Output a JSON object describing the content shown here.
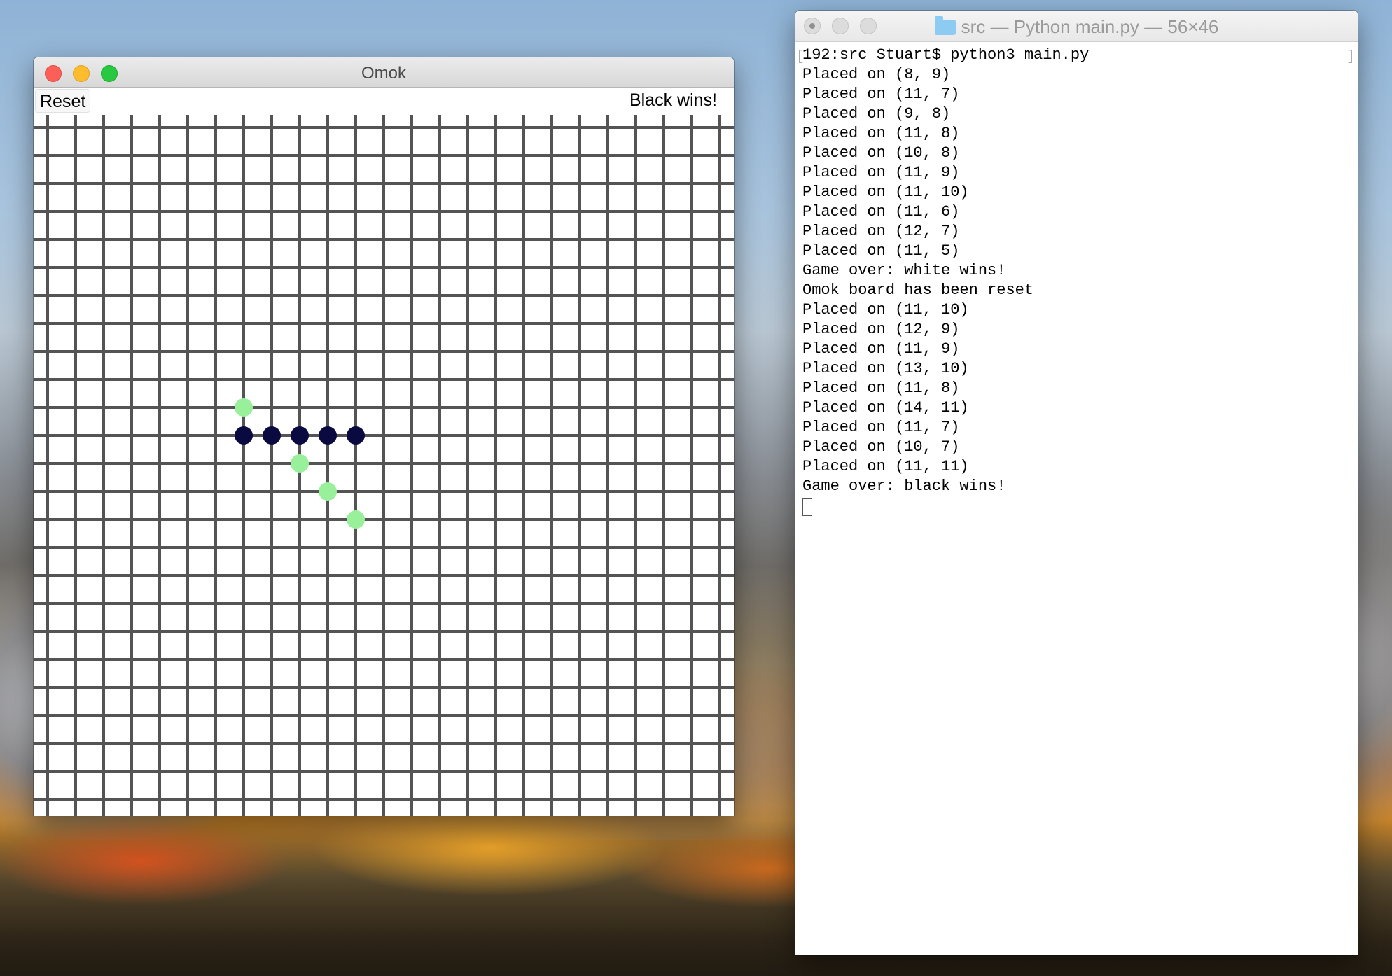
{
  "omok": {
    "window_title": "Omok",
    "reset_label": "Reset",
    "status": "Black wins!",
    "board": {
      "grid_color": "#545454",
      "black_stone_color": "#0a0a40",
      "white_stone_color": "#98f09a",
      "black_stones": [
        [
          7,
          11
        ],
        [
          8,
          11
        ],
        [
          9,
          11
        ],
        [
          10,
          11
        ],
        [
          11,
          11
        ]
      ],
      "white_stones": [
        [
          7,
          10
        ],
        [
          9,
          12
        ],
        [
          10,
          13
        ],
        [
          11,
          14
        ]
      ]
    }
  },
  "terminal": {
    "title": "src — Python main.py — 56×46",
    "lines": [
      "192:src Stuart$ python3 main.py",
      "Placed on (8, 9)",
      "Placed on (11, 7)",
      "Placed on (9, 8)",
      "Placed on (11, 8)",
      "Placed on (10, 8)",
      "Placed on (11, 9)",
      "Placed on (11, 10)",
      "Placed on (11, 6)",
      "Placed on (12, 7)",
      "Placed on (11, 5)",
      "Game over: white wins!",
      "Omok board has been reset",
      "Placed on (11, 10)",
      "Placed on (12, 9)",
      "Placed on (11, 9)",
      "Placed on (13, 10)",
      "Placed on (11, 8)",
      "Placed on (14, 11)",
      "Placed on (11, 7)",
      "Placed on (10, 7)",
      "Placed on (11, 11)",
      "Game over: black wins!"
    ]
  }
}
